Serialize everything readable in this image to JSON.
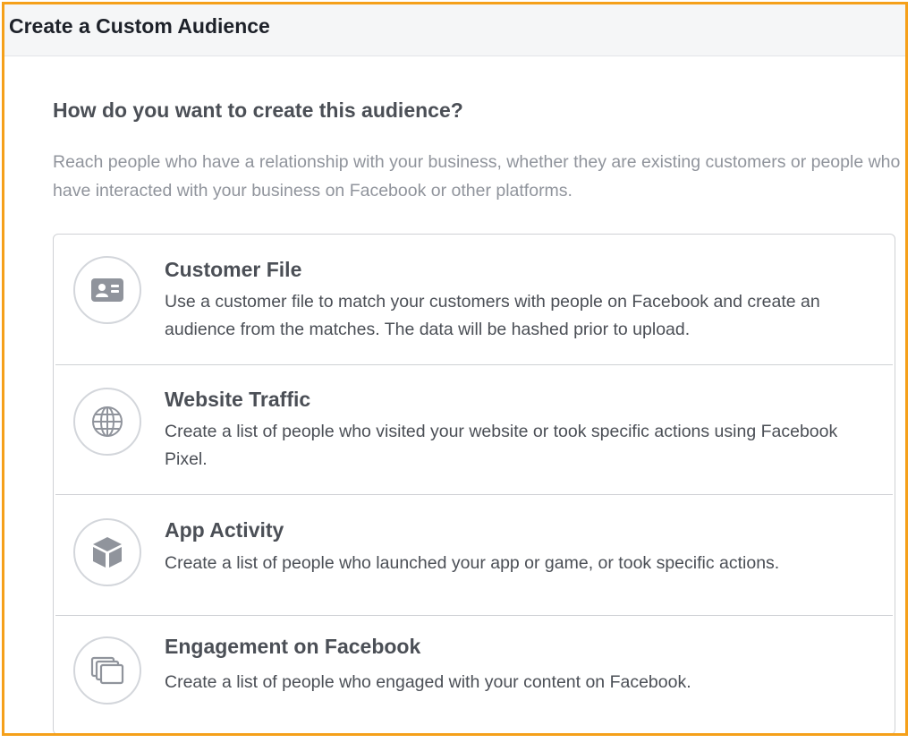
{
  "dialog": {
    "title": "Create a Custom Audience"
  },
  "prompt": {
    "question": "How do you want to create this audience?",
    "description": "Reach people who have a relationship with your business, whether they are existing customers or people who have interacted with your business on Facebook or other platforms."
  },
  "options": [
    {
      "icon": "contact-card-icon",
      "title": "Customer File",
      "description": "Use a customer file to match your customers with people on Facebook and create an audience from the matches. The data will be hashed prior to upload."
    },
    {
      "icon": "globe-icon",
      "title": "Website Traffic",
      "description": "Create a list of people who visited your website or took specific actions using Facebook Pixel."
    },
    {
      "icon": "cube-icon",
      "title": "App Activity",
      "description": "Create a list of people who launched your app or game, or took specific actions."
    },
    {
      "icon": "stacked-cards-icon",
      "title": "Engagement on Facebook",
      "description": "Create a list of people who engaged with your content on Facebook."
    }
  ],
  "colors": {
    "highlight_border": "#f5a01a",
    "header_background": "#f5f6f7",
    "title_text": "#1d2129",
    "body_text": "#4b4f56",
    "muted_text": "#90949c",
    "icon_gray": "#90949c",
    "border": "#cfd1d5"
  }
}
